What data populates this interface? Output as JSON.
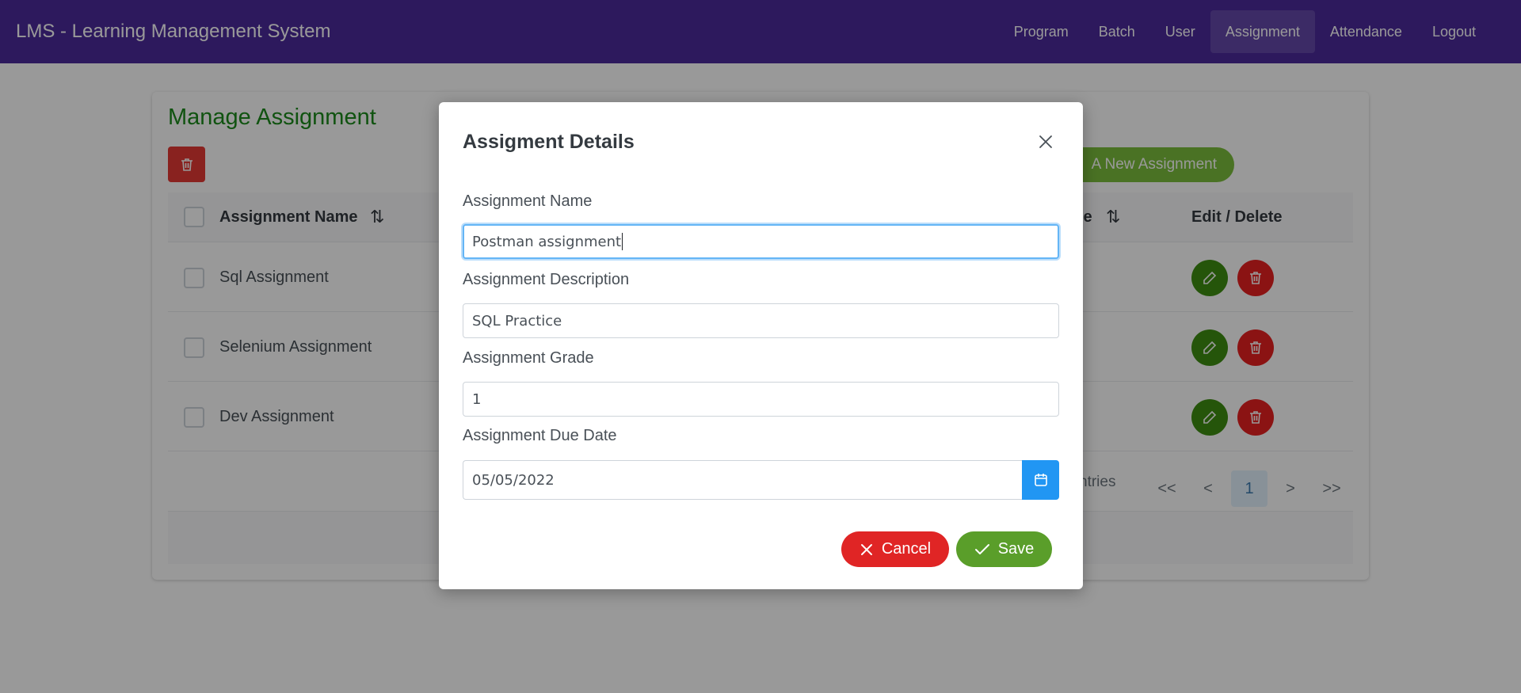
{
  "app": {
    "title": "LMS - Learning Management System",
    "colors": {
      "navbar": "#4c2a9c",
      "primary": "#2196f3",
      "success": "#5a9e2a",
      "danger": "#e02525"
    }
  },
  "nav": {
    "items": [
      {
        "label": "Program"
      },
      {
        "label": "Batch"
      },
      {
        "label": "User"
      },
      {
        "label": "Assignment",
        "active": true
      },
      {
        "label": "Attendance"
      },
      {
        "label": "Logout"
      }
    ]
  },
  "page": {
    "title": "Manage Assignment",
    "add_label": "A New Assignment",
    "table": {
      "headers": {
        "name": "Assignment Name",
        "grade_fragment": "le",
        "edit": "Edit / Delete"
      },
      "rows": [
        {
          "name": "Sql Assignment"
        },
        {
          "name": "Selenium Assignment"
        },
        {
          "name": "Dev Assignment"
        }
      ]
    },
    "paginator": {
      "entries_fragment": "ntries",
      "first": "<<",
      "prev": "<",
      "current": "1",
      "next": ">",
      "last": ">>"
    }
  },
  "dialog": {
    "title": "Assigment Details",
    "fields": {
      "name": {
        "label": "Assignment Name",
        "value": "Postman assignment"
      },
      "description": {
        "label": "Assignment Description",
        "value": "SQL Practice"
      },
      "grade": {
        "label": "Assignment Grade",
        "value": "1"
      },
      "due_date": {
        "label": "Assignment Due Date",
        "value": "05/05/2022"
      }
    },
    "cancel_label": "Cancel",
    "save_label": "Save"
  }
}
